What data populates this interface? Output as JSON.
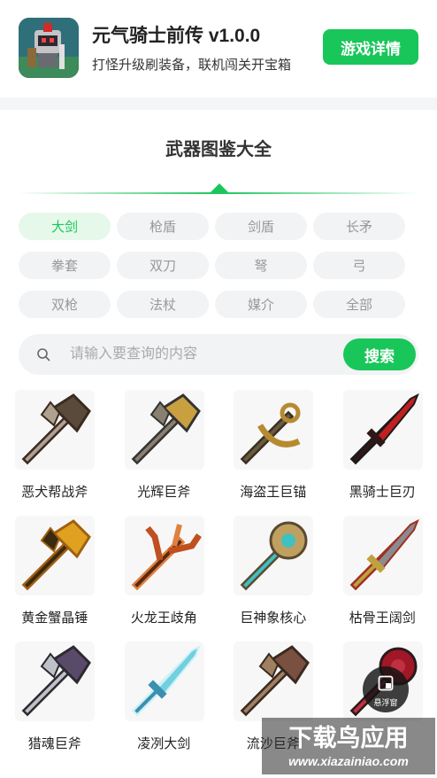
{
  "app": {
    "title": "元气骑士前传 v1.0.0",
    "subtitle": "打怪升级刷装备，联机闯关开宝箱",
    "detail_button": "游戏详情",
    "icon": "knight-character-icon"
  },
  "section": {
    "title": "武器图鉴大全"
  },
  "categories": [
    {
      "label": "大剑",
      "active": true
    },
    {
      "label": "枪盾",
      "active": false
    },
    {
      "label": "剑盾",
      "active": false
    },
    {
      "label": "长矛",
      "active": false
    },
    {
      "label": "拳套",
      "active": false
    },
    {
      "label": "双刀",
      "active": false
    },
    {
      "label": "弩",
      "active": false
    },
    {
      "label": "弓",
      "active": false
    },
    {
      "label": "双枪",
      "active": false
    },
    {
      "label": "法杖",
      "active": false
    },
    {
      "label": "媒介",
      "active": false
    },
    {
      "label": "全部",
      "active": false
    }
  ],
  "search": {
    "placeholder": "请输入要查询的内容",
    "value": "",
    "button": "搜索",
    "icon": "search-icon"
  },
  "weapons": [
    {
      "name": "恶犬帮战斧",
      "icon": "dark-battle-axe-icon",
      "colors": [
        "#5a4a3a",
        "#b0a090",
        "#3a2a20"
      ]
    },
    {
      "name": "光辉巨斧",
      "icon": "golden-axe-icon",
      "colors": [
        "#c8a040",
        "#8a8070",
        "#333333"
      ]
    },
    {
      "name": "海盗王巨锚",
      "icon": "anchor-icon",
      "colors": [
        "#b88a30",
        "#6a5a40",
        "#3a3020"
      ]
    },
    {
      "name": "黑骑士巨刃",
      "icon": "red-black-blade-icon",
      "colors": [
        "#c02020",
        "#301818",
        "#1a1a1a"
      ]
    },
    {
      "name": "黄金蟹晶锤",
      "icon": "gold-crab-hammer-icon",
      "colors": [
        "#e0a020",
        "#3a2a10",
        "#a06010"
      ]
    },
    {
      "name": "火龙王歧角",
      "icon": "fire-dragon-horn-icon",
      "colors": [
        "#c05020",
        "#5a2a10",
        "#e08040"
      ]
    },
    {
      "name": "巨神象核心",
      "icon": "core-staff-icon",
      "colors": [
        "#c0a060",
        "#40c0c0",
        "#5a4a30"
      ]
    },
    {
      "name": "枯骨王阔剑",
      "icon": "bone-king-sword-icon",
      "colors": [
        "#8a8a90",
        "#c0a040",
        "#a03020"
      ]
    },
    {
      "name": "猎魂巨斧",
      "icon": "soul-hunter-axe-icon",
      "colors": [
        "#5a4a6a",
        "#c0c0c8",
        "#2a2a30"
      ]
    },
    {
      "name": "凌冽大剑",
      "icon": "ice-greatsword-icon",
      "colors": [
        "#70d0e0",
        "#3a90b0",
        "#d0f0f8"
      ]
    },
    {
      "name": "流沙巨斧",
      "icon": "quicksand-axe-icon",
      "colors": [
        "#7a5040",
        "#a08060",
        "#3a2a20"
      ]
    },
    {
      "name": "",
      "icon": "red-orb-mace-icon",
      "colors": [
        "#a01828",
        "#c03040",
        "#2a1a1a"
      ]
    }
  ],
  "float_button": {
    "label": "悬浮窗",
    "icon": "floating-window-icon"
  },
  "watermark": {
    "title": "下载鸟应用",
    "url": "www.xiazainiao.com"
  }
}
